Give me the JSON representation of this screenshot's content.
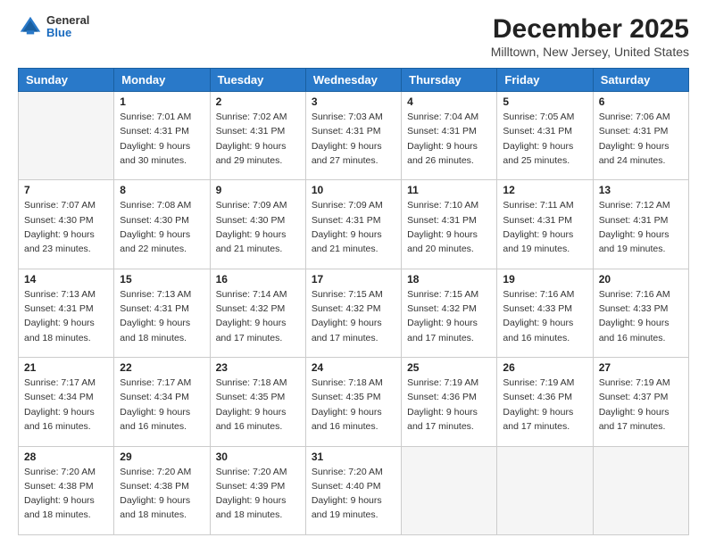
{
  "header": {
    "logo_line1": "General",
    "logo_line2": "Blue",
    "title": "December 2025",
    "subtitle": "Milltown, New Jersey, United States"
  },
  "weekdays": [
    "Sunday",
    "Monday",
    "Tuesday",
    "Wednesday",
    "Thursday",
    "Friday",
    "Saturday"
  ],
  "weeks": [
    [
      {
        "num": "",
        "info": ""
      },
      {
        "num": "1",
        "info": "Sunrise: 7:01 AM\nSunset: 4:31 PM\nDaylight: 9 hours\nand 30 minutes."
      },
      {
        "num": "2",
        "info": "Sunrise: 7:02 AM\nSunset: 4:31 PM\nDaylight: 9 hours\nand 29 minutes."
      },
      {
        "num": "3",
        "info": "Sunrise: 7:03 AM\nSunset: 4:31 PM\nDaylight: 9 hours\nand 27 minutes."
      },
      {
        "num": "4",
        "info": "Sunrise: 7:04 AM\nSunset: 4:31 PM\nDaylight: 9 hours\nand 26 minutes."
      },
      {
        "num": "5",
        "info": "Sunrise: 7:05 AM\nSunset: 4:31 PM\nDaylight: 9 hours\nand 25 minutes."
      },
      {
        "num": "6",
        "info": "Sunrise: 7:06 AM\nSunset: 4:31 PM\nDaylight: 9 hours\nand 24 minutes."
      }
    ],
    [
      {
        "num": "7",
        "info": "Sunrise: 7:07 AM\nSunset: 4:30 PM\nDaylight: 9 hours\nand 23 minutes."
      },
      {
        "num": "8",
        "info": "Sunrise: 7:08 AM\nSunset: 4:30 PM\nDaylight: 9 hours\nand 22 minutes."
      },
      {
        "num": "9",
        "info": "Sunrise: 7:09 AM\nSunset: 4:30 PM\nDaylight: 9 hours\nand 21 minutes."
      },
      {
        "num": "10",
        "info": "Sunrise: 7:09 AM\nSunset: 4:31 PM\nDaylight: 9 hours\nand 21 minutes."
      },
      {
        "num": "11",
        "info": "Sunrise: 7:10 AM\nSunset: 4:31 PM\nDaylight: 9 hours\nand 20 minutes."
      },
      {
        "num": "12",
        "info": "Sunrise: 7:11 AM\nSunset: 4:31 PM\nDaylight: 9 hours\nand 19 minutes."
      },
      {
        "num": "13",
        "info": "Sunrise: 7:12 AM\nSunset: 4:31 PM\nDaylight: 9 hours\nand 19 minutes."
      }
    ],
    [
      {
        "num": "14",
        "info": "Sunrise: 7:13 AM\nSunset: 4:31 PM\nDaylight: 9 hours\nand 18 minutes."
      },
      {
        "num": "15",
        "info": "Sunrise: 7:13 AM\nSunset: 4:31 PM\nDaylight: 9 hours\nand 18 minutes."
      },
      {
        "num": "16",
        "info": "Sunrise: 7:14 AM\nSunset: 4:32 PM\nDaylight: 9 hours\nand 17 minutes."
      },
      {
        "num": "17",
        "info": "Sunrise: 7:15 AM\nSunset: 4:32 PM\nDaylight: 9 hours\nand 17 minutes."
      },
      {
        "num": "18",
        "info": "Sunrise: 7:15 AM\nSunset: 4:32 PM\nDaylight: 9 hours\nand 17 minutes."
      },
      {
        "num": "19",
        "info": "Sunrise: 7:16 AM\nSunset: 4:33 PM\nDaylight: 9 hours\nand 16 minutes."
      },
      {
        "num": "20",
        "info": "Sunrise: 7:16 AM\nSunset: 4:33 PM\nDaylight: 9 hours\nand 16 minutes."
      }
    ],
    [
      {
        "num": "21",
        "info": "Sunrise: 7:17 AM\nSunset: 4:34 PM\nDaylight: 9 hours\nand 16 minutes."
      },
      {
        "num": "22",
        "info": "Sunrise: 7:17 AM\nSunset: 4:34 PM\nDaylight: 9 hours\nand 16 minutes."
      },
      {
        "num": "23",
        "info": "Sunrise: 7:18 AM\nSunset: 4:35 PM\nDaylight: 9 hours\nand 16 minutes."
      },
      {
        "num": "24",
        "info": "Sunrise: 7:18 AM\nSunset: 4:35 PM\nDaylight: 9 hours\nand 16 minutes."
      },
      {
        "num": "25",
        "info": "Sunrise: 7:19 AM\nSunset: 4:36 PM\nDaylight: 9 hours\nand 17 minutes."
      },
      {
        "num": "26",
        "info": "Sunrise: 7:19 AM\nSunset: 4:36 PM\nDaylight: 9 hours\nand 17 minutes."
      },
      {
        "num": "27",
        "info": "Sunrise: 7:19 AM\nSunset: 4:37 PM\nDaylight: 9 hours\nand 17 minutes."
      }
    ],
    [
      {
        "num": "28",
        "info": "Sunrise: 7:20 AM\nSunset: 4:38 PM\nDaylight: 9 hours\nand 18 minutes."
      },
      {
        "num": "29",
        "info": "Sunrise: 7:20 AM\nSunset: 4:38 PM\nDaylight: 9 hours\nand 18 minutes."
      },
      {
        "num": "30",
        "info": "Sunrise: 7:20 AM\nSunset: 4:39 PM\nDaylight: 9 hours\nand 18 minutes."
      },
      {
        "num": "31",
        "info": "Sunrise: 7:20 AM\nSunset: 4:40 PM\nDaylight: 9 hours\nand 19 minutes."
      },
      {
        "num": "",
        "info": ""
      },
      {
        "num": "",
        "info": ""
      },
      {
        "num": "",
        "info": ""
      }
    ]
  ]
}
